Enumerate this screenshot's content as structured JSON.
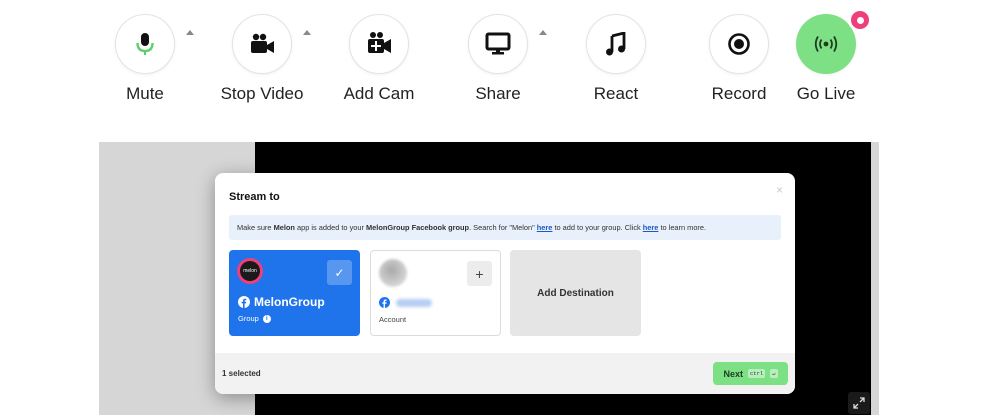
{
  "toolbar": {
    "mute_label": "Mute",
    "stop_video_label": "Stop Video",
    "add_cam_label": "Add Cam",
    "share_label": "Share",
    "react_label": "React",
    "record_label": "Record",
    "go_live_label": "Go Live"
  },
  "modal": {
    "title": "Stream to",
    "close_glyph": "×",
    "info": {
      "prefix": "Make sure ",
      "app_name": "Melon",
      "mid1": " app is added to your ",
      "group_ref": "MelonGroup Facebook group",
      "mid2": ". Search for \"Melon\" ",
      "link1": "here",
      "mid3": " to add to your group. Click ",
      "link2": "here",
      "suffix": " to learn more."
    },
    "destinations": {
      "group": {
        "logo_text": "melon",
        "name": "MelonGroup",
        "type": "Group",
        "info_glyph": "i",
        "check_glyph": "✓"
      },
      "account": {
        "type": "Account",
        "plus_glyph": "+"
      },
      "add": {
        "label": "Add Destination"
      }
    },
    "footer": {
      "selected_count": "1 selected",
      "next_label": "Next",
      "kbd_ctrl": "ctrl",
      "kbd_enter": "↵"
    }
  },
  "colors": {
    "primary_blue": "#1f74eb",
    "live_green": "#7ee084",
    "live_pink": "#ef3f7a",
    "info_bg": "#e7f0fb"
  },
  "icons": [
    "microphone-icon",
    "video-camera-icon",
    "add-camera-icon",
    "monitor-icon",
    "music-note-icon",
    "record-icon",
    "broadcast-icon",
    "facebook-icon",
    "check-icon",
    "plus-icon",
    "expand-icon"
  ]
}
